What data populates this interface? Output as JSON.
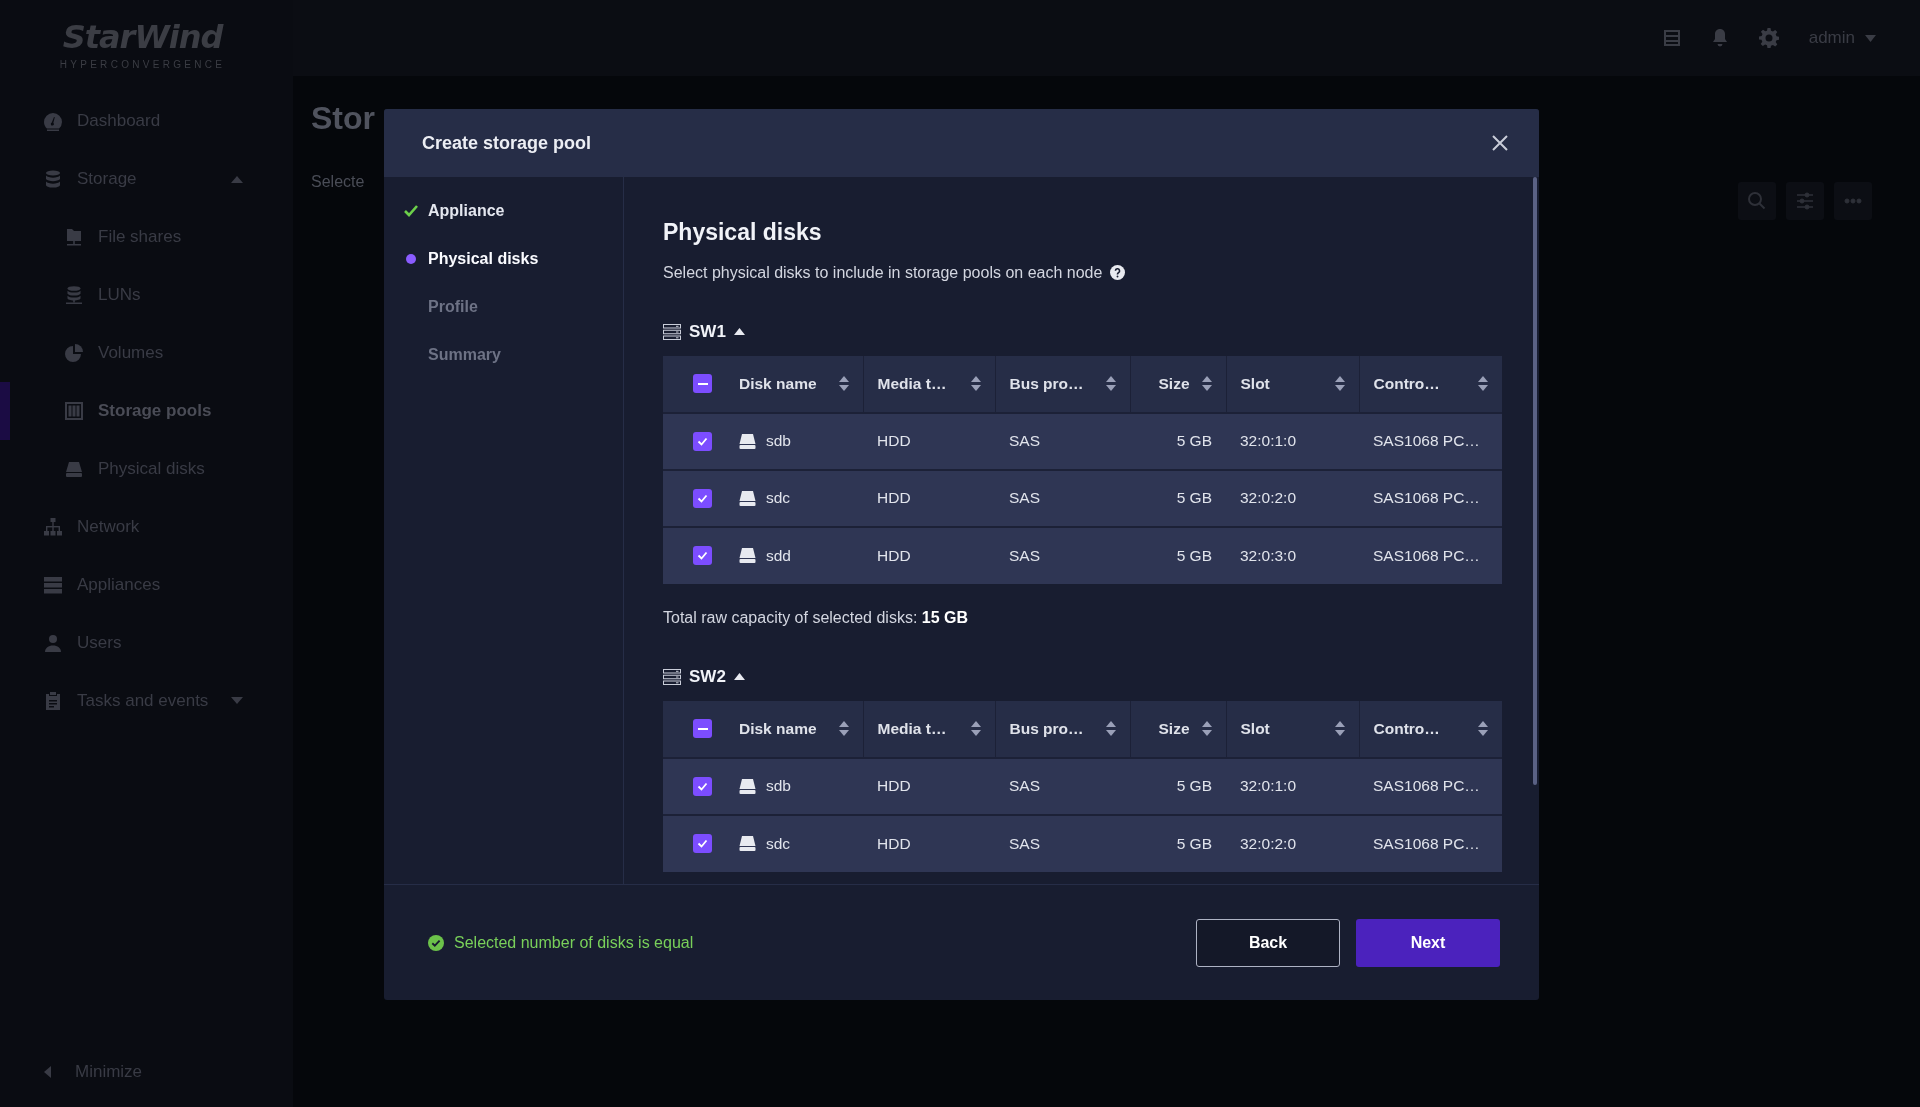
{
  "app": {
    "logo": "StarWind",
    "logo_subtitle": "HYPERCONVERGENCE"
  },
  "sidebar": {
    "items": [
      {
        "label": "Dashboard",
        "selected": false
      },
      {
        "label": "Storage",
        "selected": false,
        "expanded": true,
        "children": [
          {
            "label": "File shares",
            "selected": false
          },
          {
            "label": "LUNs",
            "selected": false
          },
          {
            "label": "Volumes",
            "selected": false
          },
          {
            "label": "Storage pools",
            "selected": true
          },
          {
            "label": "Physical disks",
            "selected": false
          }
        ]
      },
      {
        "label": "Network",
        "selected": false
      },
      {
        "label": "Appliances",
        "selected": false
      },
      {
        "label": "Users",
        "selected": false
      },
      {
        "label": "Tasks and events",
        "selected": false,
        "expanded": false
      }
    ],
    "minimize": "Minimize"
  },
  "topbar": {
    "user": "admin"
  },
  "page": {
    "title": "Stor",
    "subtitle": "Selecte"
  },
  "modal": {
    "title": "Create storage pool",
    "steps": [
      {
        "label": "Appliance",
        "completed": true,
        "selected": false
      },
      {
        "label": "Physical disks",
        "completed": false,
        "selected": true
      },
      {
        "label": "Profile",
        "completed": false,
        "selected": false
      },
      {
        "label": "Summary",
        "completed": false,
        "selected": false
      }
    ],
    "heading": "Physical disks",
    "description": "Select physical disks to include in storage pools on each node",
    "nodes": [
      {
        "name": "SW1",
        "expanded": true,
        "select_all_indeterminate": true,
        "columns": [
          {
            "label": "Disk name",
            "kind": "text"
          },
          {
            "label": "Media t…",
            "kind": "text"
          },
          {
            "label": "Bus pro…",
            "kind": "text"
          },
          {
            "label": "Size",
            "kind": "number"
          },
          {
            "label": "Slot",
            "kind": "text"
          },
          {
            "label": "Contro…",
            "kind": "text"
          }
        ],
        "rows": [
          {
            "checked": true,
            "cells": [
              "sdb",
              "HDD",
              "SAS",
              "5 GB",
              "32:0:1:0",
              "SAS1068 PC…"
            ]
          },
          {
            "checked": true,
            "cells": [
              "sdc",
              "HDD",
              "SAS",
              "5 GB",
              "32:0:2:0",
              "SAS1068 PC…"
            ]
          },
          {
            "checked": true,
            "cells": [
              "sdd",
              "HDD",
              "SAS",
              "5 GB",
              "32:0:3:0",
              "SAS1068 PC…"
            ]
          }
        ],
        "total_label": "Total raw capacity of selected disks:",
        "total_value": "15 GB"
      },
      {
        "name": "SW2",
        "expanded": true,
        "select_all_indeterminate": true,
        "columns": [
          {
            "label": "Disk name",
            "kind": "text"
          },
          {
            "label": "Media t…",
            "kind": "text"
          },
          {
            "label": "Bus pro…",
            "kind": "text"
          },
          {
            "label": "Size",
            "kind": "number"
          },
          {
            "label": "Slot",
            "kind": "text"
          },
          {
            "label": "Contro…",
            "kind": "text"
          }
        ],
        "rows": [
          {
            "checked": true,
            "cells": [
              "sdb",
              "HDD",
              "SAS",
              "5 GB",
              "32:0:1:0",
              "SAS1068 PC…"
            ]
          },
          {
            "checked": true,
            "cells": [
              "sdc",
              "HDD",
              "SAS",
              "5 GB",
              "32:0:2:0",
              "SAS1068 PC…"
            ]
          }
        ]
      }
    ],
    "status_message": "Selected number of disks is equal",
    "buttons": [
      {
        "label": "Back",
        "kind": "secondary"
      },
      {
        "label": "Next",
        "kind": "primary"
      }
    ]
  }
}
